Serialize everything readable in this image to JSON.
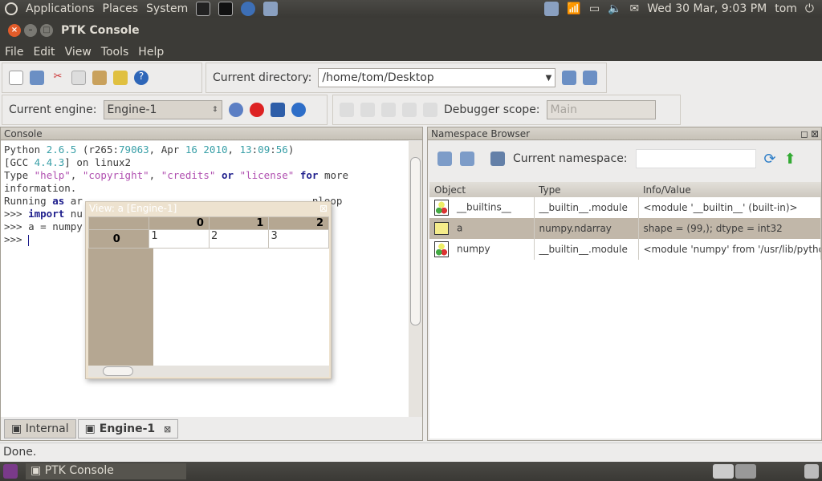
{
  "top_panel": {
    "menus": [
      "Applications",
      "Places",
      "System"
    ],
    "clock": "Wed 30 Mar,  9:03 PM",
    "user": "tom"
  },
  "window": {
    "title": "PTK Console"
  },
  "menubar": [
    "File",
    "Edit",
    "View",
    "Tools",
    "Help"
  ],
  "toolbar": {
    "current_directory_label": "Current directory:",
    "current_directory_value": "/home/tom/Desktop",
    "current_engine_label": "Current engine:",
    "current_engine_value": "Engine-1",
    "debugger_scope_label": "Debugger scope:",
    "debugger_scope_value": "Main"
  },
  "console": {
    "title": "Console",
    "lines": [
      [
        [
          "Python ",
          ""
        ],
        [
          "2.6.5",
          "n"
        ],
        [
          " (r265:",
          ""
        ],
        [
          "79063",
          "n"
        ],
        [
          ", Apr ",
          ""
        ],
        [
          "16",
          "n"
        ],
        [
          " ",
          ""
        ],
        [
          "2010",
          "n"
        ],
        [
          ", ",
          ""
        ],
        [
          "13",
          "n"
        ],
        [
          ":",
          ""
        ],
        [
          "09",
          "n"
        ],
        [
          ":",
          ""
        ],
        [
          "56",
          "n"
        ],
        [
          ")",
          ""
        ]
      ],
      [
        [
          "[GCC ",
          ""
        ],
        [
          "4.4.3",
          "n"
        ],
        [
          "] on linux2",
          ""
        ]
      ],
      [
        [
          "Type ",
          ""
        ],
        [
          "\"help\"",
          "s"
        ],
        [
          ", ",
          ""
        ],
        [
          "\"copyright\"",
          "s"
        ],
        [
          ", ",
          ""
        ],
        [
          "\"credits\"",
          "s"
        ],
        [
          " ",
          ""
        ],
        [
          "or",
          "k"
        ],
        [
          " ",
          ""
        ],
        [
          "\"license\"",
          "s"
        ],
        [
          " ",
          ""
        ],
        [
          "for",
          "k"
        ],
        [
          " more",
          ""
        ]
      ],
      [
        [
          "information.",
          ""
        ]
      ],
      [
        [
          "",
          ""
        ]
      ],
      [
        [
          "",
          ""
        ]
      ],
      [
        [
          "Running ",
          ""
        ],
        [
          "as",
          "k"
        ],
        [
          " ar                                      nloop",
          ""
        ]
      ],
      [
        [
          "",
          ""
        ]
      ],
      [
        [
          ">>> ",
          ""
        ],
        [
          "import",
          "k"
        ],
        [
          " nu",
          ""
        ]
      ],
      [
        [
          ">>> a = numpy",
          ""
        ]
      ],
      [
        [
          ">>> ",
          ""
        ]
      ]
    ],
    "tabs": [
      "Internal",
      "Engine-1"
    ]
  },
  "view_window": {
    "title": "View: a [Engine-1]",
    "col_headers": [
      "0",
      "1",
      "2"
    ],
    "row_headers": [
      "0"
    ],
    "cells": [
      [
        "1",
        "2",
        "3"
      ]
    ]
  },
  "namespace": {
    "title": "Namespace Browser",
    "current_namespace_label": "Current namespace:",
    "current_namespace_value": "",
    "columns": [
      "Object",
      "Type",
      "Info/Value"
    ],
    "rows": [
      {
        "icon": "module-icon",
        "object": "__builtins__",
        "type": "__builtin__.module",
        "info": "<module '__builtin__' (built-in)>"
      },
      {
        "icon": "array-icon",
        "object": "a",
        "type": "numpy.ndarray",
        "info": "shape = (99,); dtype = int32",
        "selected": true
      },
      {
        "icon": "module-icon",
        "object": "numpy",
        "type": "__builtin__.module",
        "info": "<module 'numpy' from '/usr/lib/pytho..."
      }
    ]
  },
  "status": "Done.",
  "taskbar": {
    "item": "PTK Console"
  }
}
